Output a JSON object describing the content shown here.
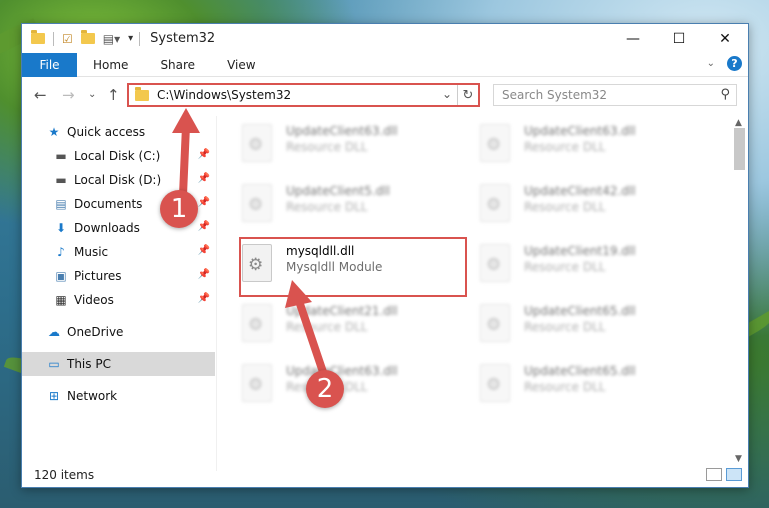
{
  "window": {
    "title": "System32",
    "controls": {
      "minimize": "—",
      "maximize": "☐",
      "close": "✕"
    }
  },
  "ribbon": {
    "tabs": [
      "File",
      "Home",
      "Share",
      "View"
    ],
    "help": "?"
  },
  "address": {
    "path": "C:\\Windows\\System32",
    "search_placeholder": "Search System32"
  },
  "sidebar": {
    "items": [
      {
        "label": "Quick access",
        "icon": "star-icon"
      },
      {
        "label": "Local Disk (C:)",
        "icon": "drive-icon"
      },
      {
        "label": "Local Disk (D:)",
        "icon": "drive-icon"
      },
      {
        "label": "Documents",
        "icon": "document-icon"
      },
      {
        "label": "Downloads",
        "icon": "download-icon"
      },
      {
        "label": "Music",
        "icon": "music-icon"
      },
      {
        "label": "Pictures",
        "icon": "picture-icon"
      },
      {
        "label": "Videos",
        "icon": "video-icon"
      },
      {
        "label": "OneDrive",
        "icon": "cloud-icon"
      },
      {
        "label": "This PC",
        "icon": "computer-icon"
      },
      {
        "label": "Network",
        "icon": "network-icon"
      }
    ]
  },
  "files": [
    {
      "name": "UpdateClient63.dll",
      "desc": "Resource DLL"
    },
    {
      "name": "UpdateClient63.dll",
      "desc": "Resource DLL"
    },
    {
      "name": "UpdateClient5.dll",
      "desc": "Resource DLL"
    },
    {
      "name": "UpdateClient42.dll",
      "desc": "Resource DLL"
    },
    {
      "name": "mysqldll.dll",
      "desc": "Mysqldll Module"
    },
    {
      "name": "UpdateClient19.dll",
      "desc": "Resource DLL"
    },
    {
      "name": "UpdateClient21.dll",
      "desc": "Resource DLL"
    },
    {
      "name": "UpdateClient65.dll",
      "desc": "Resource DLL"
    },
    {
      "name": "UpdateClient63.dll",
      "desc": "Resource DLL"
    },
    {
      "name": "UpdateClient65.dll",
      "desc": "Resource DLL"
    }
  ],
  "status": {
    "count": "120 items"
  },
  "annotations": {
    "step1": "1",
    "step2": "2"
  },
  "colors": {
    "accent": "#1979ca",
    "highlight": "#d9534f"
  }
}
